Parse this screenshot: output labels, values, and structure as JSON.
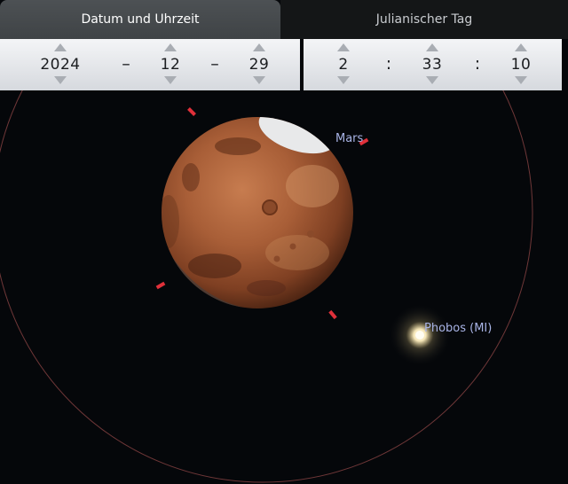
{
  "tabs": [
    {
      "label": "Datum und Uhrzeit",
      "active": true
    },
    {
      "label": "Julianischer Tag",
      "active": false
    }
  ],
  "date": {
    "year": "2024",
    "month": "12",
    "day": "29",
    "separator": "–"
  },
  "time": {
    "hour": "2",
    "minute": "33",
    "second": "10",
    "separator": ":"
  },
  "objects": {
    "mars_label": "Mars",
    "phobos_label": "Phobos (MI)"
  },
  "colors": {
    "selection_marker": "#e0303a",
    "fov_circle": "#8a4444",
    "label": "#a9b4e6"
  }
}
